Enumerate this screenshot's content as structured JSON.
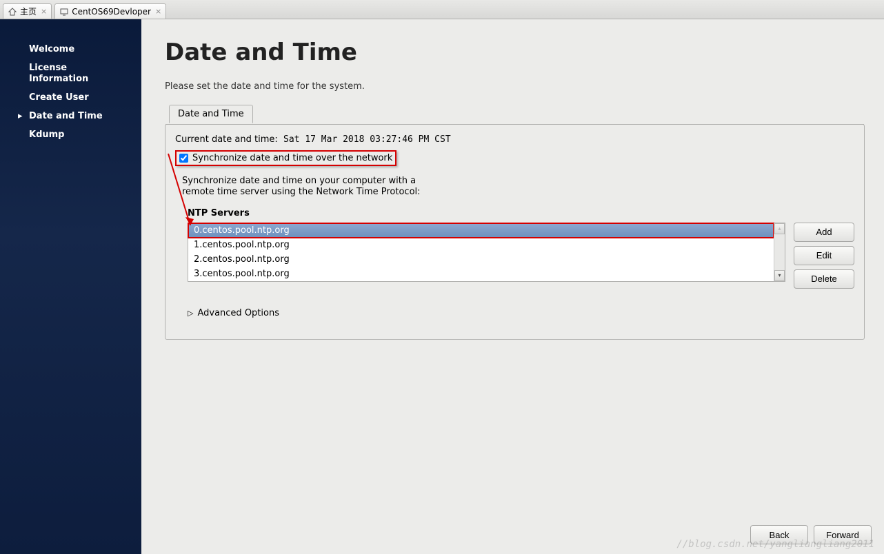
{
  "tabs": [
    {
      "label": "主页",
      "icon": "home"
    },
    {
      "label": "CentOS69Devloper",
      "icon": "monitor"
    }
  ],
  "sidebar": {
    "items": [
      {
        "label": "Welcome"
      },
      {
        "label": "License Information"
      },
      {
        "label": "Create User"
      },
      {
        "label": "Date and Time",
        "active": true
      },
      {
        "label": "Kdump"
      }
    ]
  },
  "page": {
    "title": "Date and Time",
    "subtitle": "Please set the date and time for the system."
  },
  "panel": {
    "tab_label": "Date and Time",
    "current_label": "Current date and time:",
    "current_value": "Sat 17 Mar 2018 03:27:46 PM CST",
    "sync_label": "Synchronize date and time over the network",
    "sync_checked": true,
    "desc_line1": "Synchronize date and time on your computer with a",
    "desc_line2": "remote time server using the Network Time Protocol:",
    "ntp_label": "NTP Servers",
    "servers": [
      "0.centos.pool.ntp.org",
      "1.centos.pool.ntp.org",
      "2.centos.pool.ntp.org",
      "3.centos.pool.ntp.org"
    ],
    "selected_index": 0,
    "buttons": {
      "add": "Add",
      "edit": "Edit",
      "delete": "Delete"
    },
    "advanced": "Advanced Options"
  },
  "footer": {
    "back": "Back",
    "forward": "Forward"
  },
  "watermark": "//blog.csdn.net/yangliangliang2011"
}
